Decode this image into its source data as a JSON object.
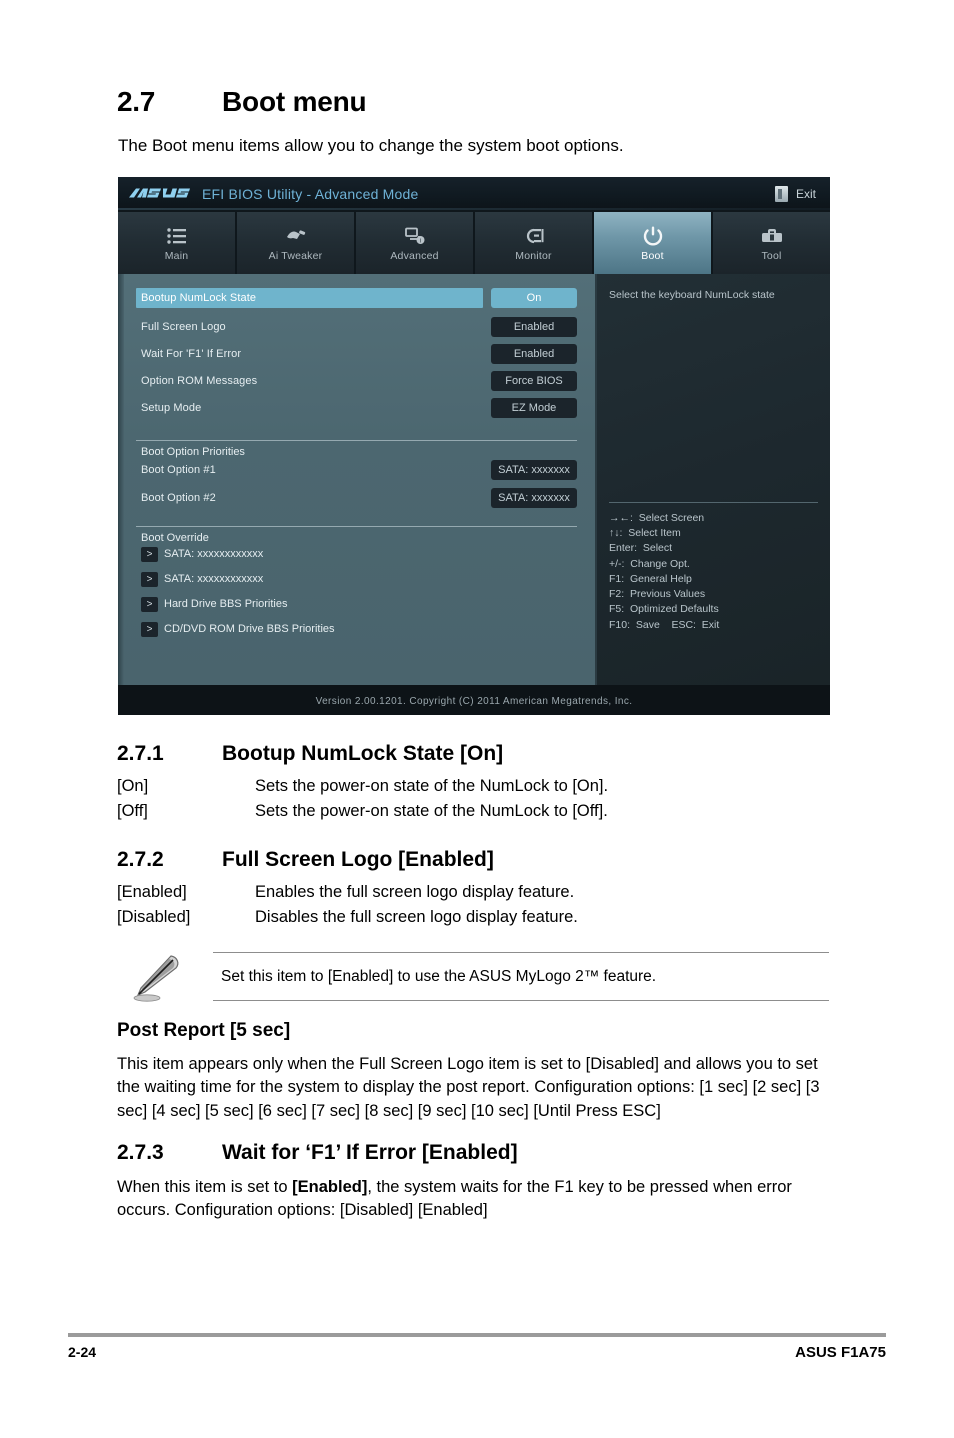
{
  "document": {
    "section_number": "2.7",
    "section_title": "Boot menu",
    "intro": "The Boot menu items allow you to change the system boot options.",
    "footer_page": "2-24",
    "footer_model": "ASUS F1A75"
  },
  "bios": {
    "logo_alt": "asus-logo",
    "title": "EFI BIOS Utility - Advanced Mode",
    "exit_label": "Exit",
    "tabs": [
      {
        "label": "Main",
        "icon": "list-icon",
        "active": false
      },
      {
        "label": "Ai  Tweaker",
        "icon": "tweaker-icon",
        "active": false
      },
      {
        "label": "Advanced",
        "icon": "advanced-icon",
        "active": false
      },
      {
        "label": "Monitor",
        "icon": "monitor-icon",
        "active": false
      },
      {
        "label": "Boot",
        "icon": "power-icon",
        "active": true
      },
      {
        "label": "Tool",
        "icon": "toolbox-icon",
        "active": false
      }
    ],
    "items": [
      {
        "label": "Bootup NumLock State",
        "value": "On",
        "selected": true
      },
      {
        "label": "Full Screen Logo",
        "value": "Enabled",
        "selected": false
      },
      {
        "label": "Wait For 'F1' If Error",
        "value": "Enabled",
        "selected": false
      },
      {
        "label": "Option ROM Messages",
        "value": "Force BIOS",
        "selected": false
      },
      {
        "label": "Setup Mode",
        "value": "EZ Mode",
        "selected": false
      }
    ],
    "boot_priorities": {
      "group_title": "Boot Option Priorities",
      "items": [
        {
          "label": "Boot Option #1",
          "value": "SATA: xxxxxxx"
        },
        {
          "label": "Boot Option #2",
          "value": "SATA: xxxxxxx"
        }
      ]
    },
    "boot_override": {
      "group_title": "Boot Override",
      "arrow": ">",
      "items": [
        {
          "label": "SATA: xxxxxxxxxxxx"
        },
        {
          "label": "SATA: xxxxxxxxxxxx"
        },
        {
          "label": "Hard Drive BBS Priorities"
        },
        {
          "label": "CD/DVD ROM Drive BBS Priorities"
        }
      ]
    },
    "help_text": "Select the keyboard NumLock state",
    "legend": [
      "→←:  Select Screen",
      "↑↓:  Select Item",
      "Enter:  Select",
      "+/-:  Change Opt.",
      "F1:  General Help",
      "F2:  Previous Values",
      "F5:  Optimized Defaults",
      "F10:  Save    ESC:  Exit"
    ],
    "footer": "Version  2.00.1201.   Copyright  (C)  2011  American  Megatrends,  Inc.",
    "colors": {
      "accent": "#6fb4cc",
      "panel_left": "#4c6770",
      "panel_right": "#1d282e",
      "title_blue": "#6fb2d6"
    }
  },
  "sections": {
    "s271": {
      "number": "2.7.1",
      "title": "Bootup NumLock State [On]",
      "rows": [
        {
          "key": "[On]",
          "value": "Sets the power-on state of the NumLock to [On]."
        },
        {
          "key": "[Off]",
          "value": "Sets the power-on state of the NumLock to [Off]."
        }
      ]
    },
    "s272": {
      "number": "2.7.2",
      "title": "Full Screen Logo [Enabled]",
      "rows": [
        {
          "key": "[Enabled]",
          "value": "Enables the full screen logo display feature."
        },
        {
          "key": "[Disabled]",
          "value": "Disables the full screen logo display feature."
        }
      ],
      "note": "Set this item to [Enabled] to use the ASUS MyLogo 2™ feature."
    },
    "post_report": {
      "title": "Post Report [5 sec]",
      "body": "This item appears only when the Full Screen Logo item is set to [Disabled] and allows you to set the waiting time for the system to display the post report. Configuration options: [1 sec] [2 sec] [3 sec] [4 sec] [5 sec] [6 sec] [7 sec] [8 sec] [9 sec] [10 sec] [Until Press ESC]"
    },
    "s273": {
      "number": "2.7.3",
      "title": "Wait for ‘F1’ If Error [Enabled]",
      "body_pre": "When this item is set to ",
      "body_bold": "[Enabled]",
      "body_post": ", the system waits for the F1 key to be pressed when error occurs. Configuration options: [Disabled] [Enabled]"
    }
  }
}
